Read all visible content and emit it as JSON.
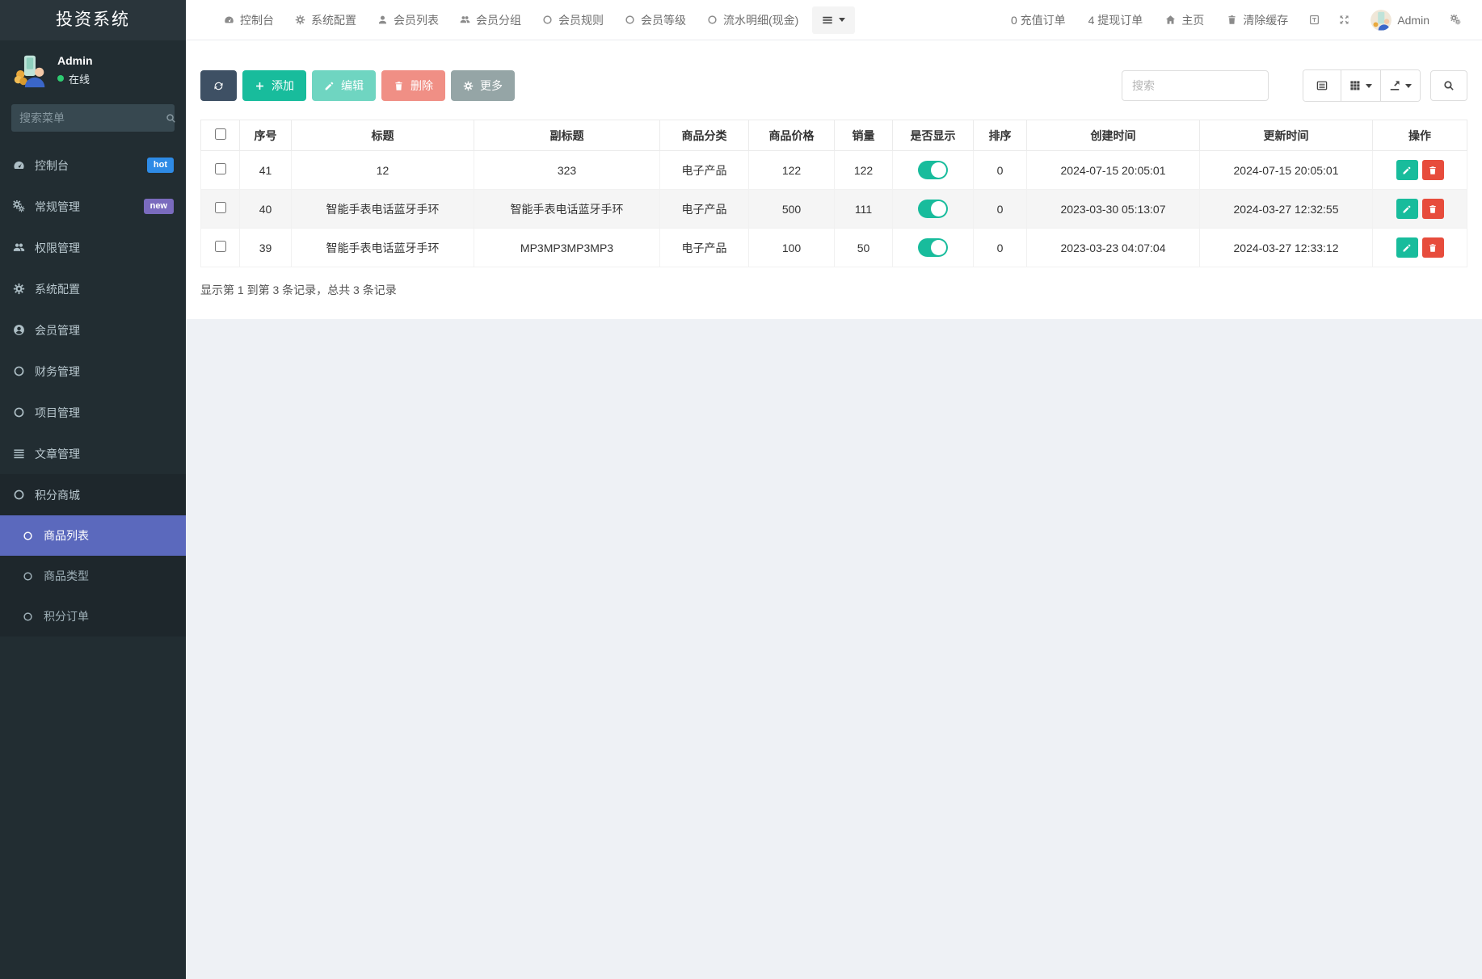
{
  "app": {
    "title": "投资系统"
  },
  "sidebar": {
    "user": {
      "name": "Admin",
      "status": "在线"
    },
    "search_placeholder": "搜索菜单",
    "items": [
      {
        "label": "控制台",
        "icon": "dashboard",
        "badge": "hot",
        "badge_color": "#2e8be6"
      },
      {
        "label": "常规管理",
        "icon": "cogs",
        "badge": "new",
        "badge_color": "#7a6bbe"
      },
      {
        "label": "权限管理",
        "icon": "users",
        "chevron": "left"
      },
      {
        "label": "系统配置",
        "icon": "gear"
      },
      {
        "label": "会员管理",
        "icon": "user-circle",
        "chevron": "left"
      },
      {
        "label": "财务管理",
        "icon": "circle",
        "chevron": "left"
      },
      {
        "label": "项目管理",
        "icon": "circle",
        "chevron": "left"
      },
      {
        "label": "文章管理",
        "icon": "list",
        "chevron": "left"
      },
      {
        "label": "积分商城",
        "icon": "circle",
        "chevron": "down",
        "expanded": true
      }
    ],
    "submenu": [
      {
        "label": "商品列表",
        "active": true
      },
      {
        "label": "商品类型",
        "active": false
      },
      {
        "label": "积分订单",
        "active": false
      }
    ]
  },
  "topnav": {
    "items": [
      {
        "label": "控制台",
        "icon": "dashboard"
      },
      {
        "label": "系统配置",
        "icon": "gear"
      },
      {
        "label": "会员列表",
        "icon": "user"
      },
      {
        "label": "会员分组",
        "icon": "users"
      },
      {
        "label": "会员规则",
        "icon": "circle"
      },
      {
        "label": "会员等级",
        "icon": "circle"
      },
      {
        "label": "流水明细(现金)",
        "icon": "circle"
      }
    ],
    "right": {
      "recharge_orders": "0 充值订单",
      "withdraw_orders": "4 提现订单",
      "home": "主页",
      "clear_cache": "清除缓存",
      "username": "Admin"
    }
  },
  "toolbar": {
    "add": "添加",
    "edit": "编辑",
    "delete": "删除",
    "more": "更多",
    "search_placeholder": "搜索"
  },
  "table": {
    "columns": [
      "序号",
      "标题",
      "副标题",
      "商品分类",
      "商品价格",
      "销量",
      "是否显示",
      "排序",
      "创建时间",
      "更新时间",
      "操作"
    ],
    "rows": [
      {
        "id": "41",
        "title": "12",
        "subtitle": "323",
        "category": "电子产品",
        "price": "122",
        "sales": "122",
        "visible": true,
        "sort": "0",
        "created": "2024-07-15 20:05:01",
        "updated": "2024-07-15 20:05:01"
      },
      {
        "id": "40",
        "title": "智能手表电话蓝牙手环",
        "subtitle": "智能手表电话蓝牙手环",
        "category": "电子产品",
        "price": "500",
        "sales": "111",
        "visible": true,
        "sort": "0",
        "created": "2023-03-30 05:13:07",
        "updated": "2024-03-27 12:32:55"
      },
      {
        "id": "39",
        "title": "智能手表电话蓝牙手环",
        "subtitle": "MP3MP3MP3MP3",
        "category": "电子产品",
        "price": "100",
        "sales": "50",
        "visible": true,
        "sort": "0",
        "created": "2023-03-23 04:07:04",
        "updated": "2024-03-27 12:33:12"
      }
    ],
    "footer": "显示第 1 到第 3 条记录，总共 3 条记录"
  },
  "colors": {
    "sidebar_bg": "#222d32",
    "sidebar_active": "#5b69bd",
    "accent_green": "#18bc9c",
    "danger_red": "#e74c3c",
    "dark_button": "#3e5064",
    "muted_button": "#95a5a6",
    "badge_hot": "#2e8be6",
    "badge_new": "#7a6bbe",
    "toggle_on": "#18bc9c",
    "page_bg": "#eef1f5"
  }
}
